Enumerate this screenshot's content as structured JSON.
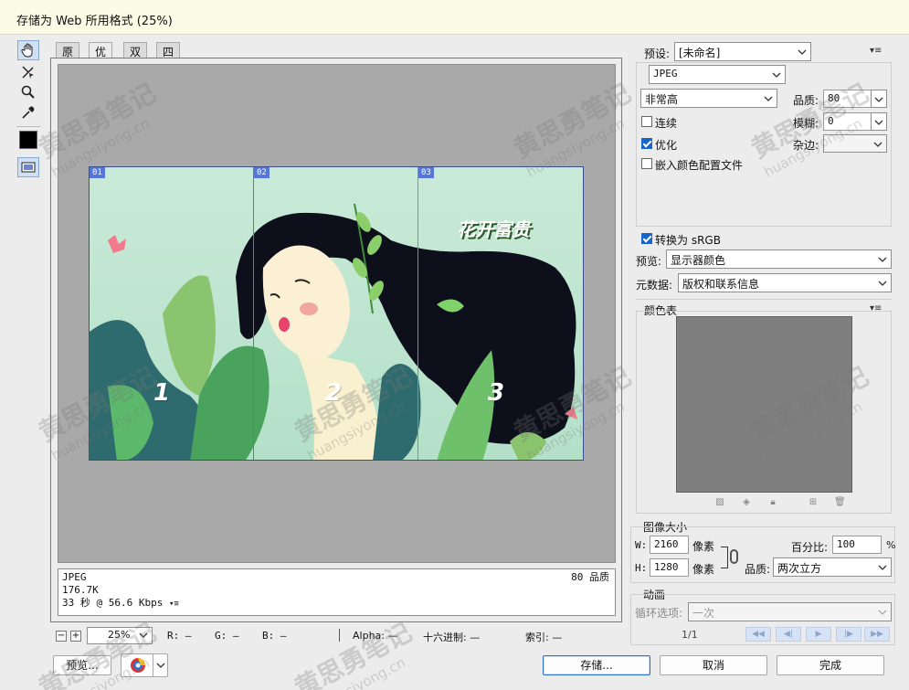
{
  "window": {
    "title": "存储为 Web 所用格式 (25%)"
  },
  "tabs": [
    {
      "label": "原稿",
      "active": false
    },
    {
      "label": "优化",
      "active": true
    },
    {
      "label": "双联",
      "active": false
    },
    {
      "label": "四联",
      "active": false
    }
  ],
  "tools": [
    "hand-icon",
    "slice-select-icon",
    "zoom-icon",
    "eyedropper-icon",
    "color-swatch",
    "slice-visibility-icon"
  ],
  "artwork": {
    "title_text": "花开富贵",
    "slices": [
      {
        "tag": "01",
        "number": "1"
      },
      {
        "tag": "02",
        "number": "2"
      },
      {
        "tag": "03",
        "number": "3"
      }
    ]
  },
  "info": {
    "format": "JPEG",
    "size": "176.7K",
    "speed": "33 秒 @ 56.6 Kbps",
    "quality_note": "80 品质"
  },
  "statusbar": {
    "zoom": "25%",
    "r_label": "R:",
    "r_value": "—",
    "g_label": "G:",
    "g_value": "—",
    "b_label": "B:",
    "b_value": "—",
    "alpha_label": "Alpha:",
    "alpha_value": "—",
    "hex_label": "十六进制:",
    "hex_value": "—",
    "index_label": "索引:",
    "index_value": "—"
  },
  "buttons": {
    "preview": "预览...",
    "save": "存储...",
    "cancel": "取消",
    "done": "完成"
  },
  "settings": {
    "preset_label": "预设:",
    "preset_value": "[未命名]",
    "format_value": "JPEG",
    "quality_level": "非常高",
    "quality_label": "品质:",
    "quality_value": "80",
    "progressive_label": "连续",
    "progressive_checked": false,
    "blur_label": "模糊:",
    "blur_value": "0",
    "optimized_label": "优化",
    "optimized_checked": true,
    "matte_label": "杂边:",
    "embed_profile_label": "嵌入颜色配置文件",
    "embed_profile_checked": false,
    "convert_srgb_label": "转换为 sRGB",
    "convert_srgb_checked": true,
    "preview_label": "预览:",
    "preview_value": "显示器颜色",
    "metadata_label": "元数据:",
    "metadata_value": "版权和联系信息"
  },
  "color_table": {
    "label": "颜色表"
  },
  "image_size": {
    "label": "图像大小",
    "w_label": "W:",
    "w_value": "2160",
    "h_label": "H:",
    "h_value": "1280",
    "unit": "像素",
    "percent_label": "百分比:",
    "percent_value": "100",
    "percent_unit": "%",
    "quality_label": "品质:",
    "quality_value": "两次立方"
  },
  "animation": {
    "label": "动画",
    "loop_label": "循环选项:",
    "loop_value": "一次",
    "frame_counter": "1/1"
  },
  "watermark": {
    "text": "黄思勇笔记",
    "url": "huangsiyong.cn"
  },
  "colors": {
    "accent": "#1a65c9",
    "slice_tag": "#5677d9",
    "titlebar": "#fbfbe6"
  }
}
